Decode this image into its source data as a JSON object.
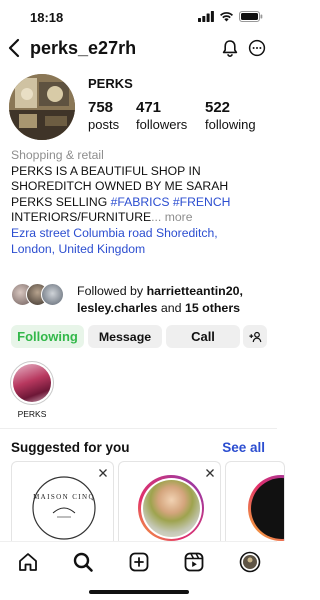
{
  "status_bar": {
    "time": "18:18"
  },
  "header": {
    "username": "perks_e27rh"
  },
  "profile": {
    "display_name": "PERKS",
    "stats": [
      {
        "value": "758",
        "label": "posts"
      },
      {
        "value": "471",
        "label": "followers"
      },
      {
        "value": "522",
        "label": "following"
      }
    ],
    "category": "Shopping & retail",
    "bio_line1": "PERKS IS A BEAUTIFUL SHOP IN",
    "bio_line2": "SHOREDITCH OWNED BY ME SARAH",
    "bio_line3_text": "PERKS SELLING ",
    "bio_hashtag1": "#FABRICS",
    "bio_hashtag2": "#FRENCH",
    "bio_line4_text": "INTERIORS/FURNITURE",
    "bio_more": "... more",
    "location_line1": "Ezra street Columbia road Shoreditch,",
    "location_line2": "London, United Kingdom"
  },
  "followed_by": {
    "prefix": "Followed by ",
    "name1": "harrietteantin20",
    "name2": "lesley.charles",
    "conj": " and ",
    "others": "15 others"
  },
  "buttons": {
    "following": "Following",
    "message": "Message",
    "call": "Call"
  },
  "highlights": [
    {
      "label": "PERKS"
    }
  ],
  "suggested": {
    "title": "Suggested for you",
    "see_all": "See all",
    "logo_text": "MAISON CINQ"
  },
  "colors": {
    "link": "#2c4ed0",
    "following_text": "#33b84a",
    "following_bg": "#e8f5e9",
    "secondary_text": "#8e8e8e"
  },
  "icons": [
    "back-arrow-icon",
    "bell-icon",
    "more-icon",
    "add-user-icon",
    "close-icon",
    "home-icon",
    "search-icon",
    "create-icon",
    "reels-icon",
    "profile-icon",
    "signal-icon",
    "wifi-icon",
    "battery-icon"
  ]
}
